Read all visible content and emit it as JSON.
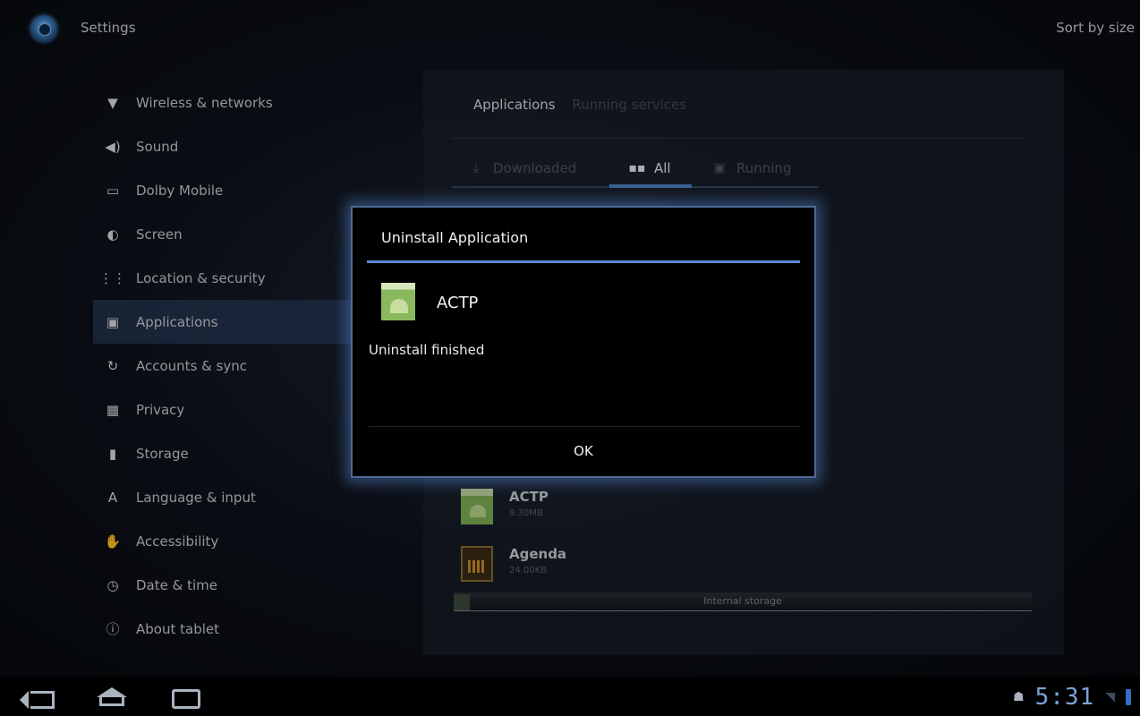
{
  "action_bar": {
    "title": "Settings",
    "sort_label": "Sort by size"
  },
  "sidebar": {
    "items": [
      {
        "label": "Wireless & networks",
        "icon": "▼"
      },
      {
        "label": "Sound",
        "icon": "◀)"
      },
      {
        "label": "Dolby Mobile",
        "icon": "▭"
      },
      {
        "label": "Screen",
        "icon": "◐"
      },
      {
        "label": "Location & security",
        "icon": "⋮⋮"
      },
      {
        "label": "Applications",
        "icon": "▣"
      },
      {
        "label": "Accounts & sync",
        "icon": "↻"
      },
      {
        "label": "Privacy",
        "icon": "▦"
      },
      {
        "label": "Storage",
        "icon": "▮"
      },
      {
        "label": "Language & input",
        "icon": "A"
      },
      {
        "label": "Accessibility",
        "icon": "✋"
      },
      {
        "label": "Date & time",
        "icon": "◷"
      },
      {
        "label": "About tablet",
        "icon": "ⓘ"
      }
    ],
    "active_index": 5
  },
  "content": {
    "top_tabs": {
      "active": "Applications",
      "inactive": "Running services"
    },
    "filter_tabs": {
      "downloaded": "Downloaded",
      "all": "All",
      "running": "Running"
    },
    "apps": [
      {
        "name": "ACTP",
        "size": "9.30MB"
      },
      {
        "name": "Agenda",
        "size": "24.00KB"
      }
    ],
    "storage_label": "Internal storage"
  },
  "dialog": {
    "title": "Uninstall Application",
    "app_name": "ACTP",
    "message": "Uninstall finished",
    "ok_label": "OK"
  },
  "system_bar": {
    "clock": "5:31"
  }
}
